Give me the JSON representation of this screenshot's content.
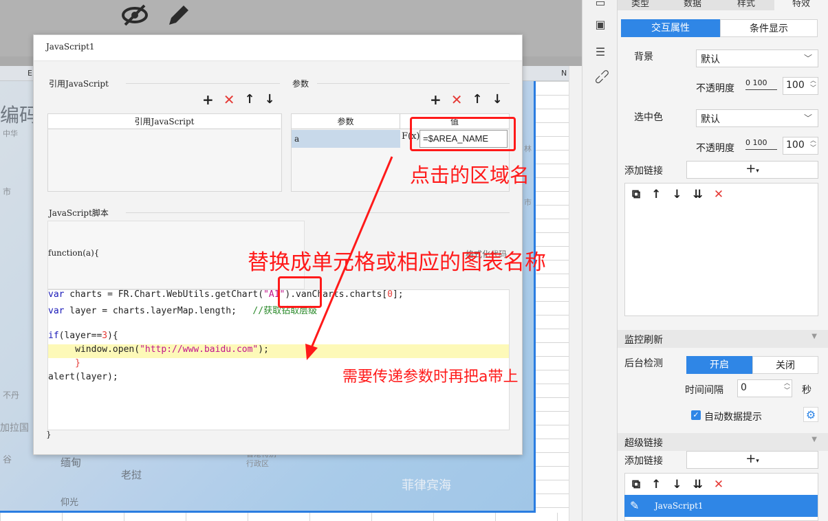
{
  "canvas": {
    "ruler_labels": [
      "E",
      "N"
    ],
    "map_labels": [
      "编码",
      "中华",
      "市",
      "不丹",
      "加拉国",
      "谷",
      "缅甸",
      "老挝",
      "香港特别",
      "行政区",
      "菲律宾海",
      "仰光",
      "林",
      "市"
    ]
  },
  "dialog": {
    "title": "JavaScript1",
    "ref_js": {
      "label": "引用JavaScript",
      "column": "引用JavaScript"
    },
    "params": {
      "label": "参数",
      "columns": [
        "参数",
        "值"
      ],
      "rows": [
        {
          "name": "a",
          "value": "=$AREA_NAME"
        }
      ],
      "fx": "F(x)"
    },
    "script": {
      "label": "JavaScript脚本",
      "header": "function(a){",
      "footer": "}",
      "format_hint": "格式化代码"
    },
    "ops": {
      "add": "+",
      "delete": "✕",
      "up": "↑",
      "down": "↓"
    }
  },
  "code": {
    "l1_kw": "var",
    "l1_a": " charts = FR.Chart.WebUtils.getChart(",
    "l1_str": "\"A1\"",
    "l1_b": ").vanCharts.charts[",
    "l1_num": "0",
    "l1_c": "];",
    "l2_kw": "var",
    "l2_a": " layer = charts.layerMap.length;   ",
    "l2_cmt": "//获取钻取层级",
    "l3_kw": "if",
    "l3_a": "(layer==",
    "l3_num": "3",
    "l3_b": "){",
    "l4_a": "     window.open(",
    "l4_str": "\"http://www.baidu.com\"",
    "l4_b": ");",
    "l5": "     }",
    "l6": "alert(layer);"
  },
  "annotations": {
    "area_name": "点击的区域名",
    "replace": "替换成单元格或相应的图表名称",
    "pass_param": "需要传递参数时再把a带上"
  },
  "panel": {
    "tabs": [
      "类型",
      "数据",
      "样式",
      "特效"
    ],
    "subtabs": {
      "active": "交互属性",
      "inactive": "条件显示"
    },
    "background": {
      "label": "背景",
      "value": "默认"
    },
    "opacity_label": "不透明度",
    "slider_range": "0 100",
    "opacity_value": "100",
    "selected_color": {
      "label": "选中色",
      "value": "默认"
    },
    "opacity_value_2": "100",
    "add_link": "添加链接",
    "monitor": {
      "header": "监控刷新",
      "backend_check": "后台检测",
      "on": "开启",
      "off": "关闭",
      "interval_label": "时间间隔",
      "interval_value": "0",
      "unit": "秒",
      "auto_hint": "自动数据提示"
    },
    "hyperlink": {
      "header": "超级链接",
      "add_link": "添加链接",
      "item": "JavaScript1"
    }
  },
  "colors": {
    "accent": "#2f86e6",
    "annotation": "#ff1a1a"
  }
}
